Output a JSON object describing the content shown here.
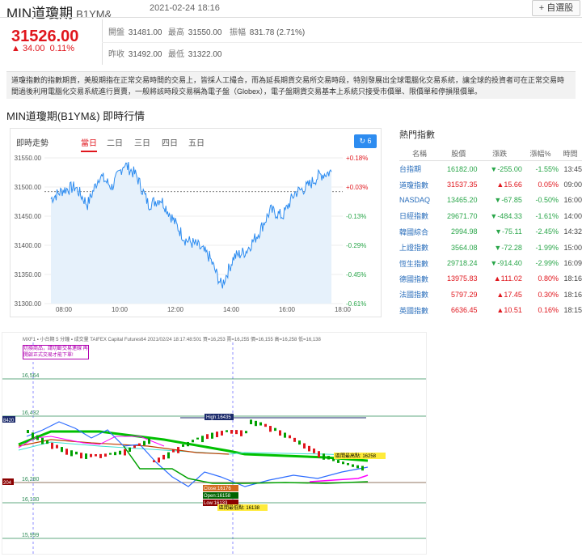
{
  "header": {
    "title": "MIN道瓊期",
    "code": "B1YM&",
    "datetime": "2021-02-24 18:16",
    "watch_button": "+ 自選股"
  },
  "quote": {
    "price": "31526.00",
    "change": "▲ 34.00",
    "change_pct": "0.11%",
    "open_label": "開盤",
    "open": "31481.00",
    "high_label": "最高",
    "high": "31550.00",
    "amp_label": "振幅",
    "amp": "831.78 (2.71%)",
    "prev_label": "昨收",
    "prev": "31492.00",
    "low_label": "最低",
    "low": "31322.00"
  },
  "description": "道瓊指數的指數期貨，美股期指在正常交易時間的交易上，皆採人工撮合，而為延長期貨交易所交易時段，特別發展出全球電腦化交易系統，讓全球的投資者可在正常交易時間過後利用電腦化交易系統進行買賣，一般將該時段交易稱為電子盤（Globex），電子盤期貨交易基本上系統只接受市價單、限價單和停損限價單。",
  "subtitle": "MIN道瓊期(B1YM&) 即時行情",
  "chart_panel": {
    "title": "即時走勢",
    "tabs": [
      "當日",
      "二日",
      "三日",
      "四日",
      "五日"
    ],
    "active_tab": "當日",
    "refresh_label": "↻ 6",
    "y_ticks": [
      "31550.00",
      "31500.00",
      "31450.00",
      "31400.00",
      "31350.00",
      "31300.00"
    ],
    "pct_ticks": [
      "+0.18%",
      "+0.03%",
      "-0.13%",
      "-0.29%",
      "-0.45%",
      "-0.61%"
    ],
    "x_ticks": [
      "08:00",
      "10:00",
      "12:00",
      "14:00",
      "16:00",
      "18:00"
    ]
  },
  "chart_data": {
    "type": "line",
    "title": "即時走勢",
    "x": [
      "07:00",
      "07:30",
      "08:00",
      "08:30",
      "09:00",
      "09:30",
      "10:00",
      "10:30",
      "11:00",
      "11:30",
      "12:00",
      "12:30",
      "13:00",
      "13:30",
      "14:00",
      "14:30",
      "15:00",
      "15:30",
      "16:00",
      "16:30",
      "17:00",
      "17:30",
      "18:00",
      "18:16"
    ],
    "values": [
      31480,
      31495,
      31500,
      31470,
      31520,
      31500,
      31540,
      31520,
      31470,
      31480,
      31445,
      31410,
      31400,
      31380,
      31330,
      31380,
      31390,
      31420,
      31460,
      31450,
      31490,
      31500,
      31520,
      31526
    ],
    "reference": 31492,
    "ylim": [
      31300,
      31550
    ],
    "grid": true
  },
  "hot": {
    "title": "熱門指數",
    "headers": [
      "名稱",
      "股價",
      "漲跌",
      "漲幅%",
      "時間"
    ],
    "rows": [
      {
        "name": "台指期",
        "price": "16182.00",
        "change": "▼-255.00",
        "pct": "-1.55%",
        "time": "13:45",
        "dir": "dn"
      },
      {
        "name": "道瓊指數",
        "price": "31537.35",
        "change": "▲15.66",
        "pct": "0.05%",
        "time": "09:00",
        "dir": "up"
      },
      {
        "name": "NASDAQ",
        "price": "13465.20",
        "change": "▼-67.85",
        "pct": "-0.50%",
        "time": "16:00",
        "dir": "dn"
      },
      {
        "name": "日經指數",
        "price": "29671.70",
        "change": "▼-484.33",
        "pct": "-1.61%",
        "time": "14:00",
        "dir": "dn"
      },
      {
        "name": "韓國綜合",
        "price": "2994.98",
        "change": "▼-75.11",
        "pct": "-2.45%",
        "time": "14:32",
        "dir": "dn"
      },
      {
        "name": "上證指數",
        "price": "3564.08",
        "change": "▼-72.28",
        "pct": "-1.99%",
        "time": "15:00",
        "dir": "dn"
      },
      {
        "name": "恆生指數",
        "price": "29718.24",
        "change": "▼-914.40",
        "pct": "-2.99%",
        "time": "16:09",
        "dir": "dn"
      },
      {
        "name": "德國指數",
        "price": "13975.83",
        "change": "▲111.02",
        "pct": "0.80%",
        "time": "18:16",
        "dir": "up"
      },
      {
        "name": "法國指數",
        "price": "5797.29",
        "change": "▲17.45",
        "pct": "0.30%",
        "time": "18:16",
        "dir": "up"
      },
      {
        "name": "英國指數",
        "price": "6636.45",
        "change": "▲10.51",
        "pct": "0.16%",
        "time": "18:15",
        "dir": "up"
      }
    ]
  },
  "tv": {
    "toolbar": "MXF1 ▪ 小台期 5 分鐘 ▪ 成交量 TAIFEX Capital Futures64 2021/02/24 18:17:48:501 買=16,253 賣=16,255 價=16,155 高=16,258 低=16,138",
    "notice": "切換商品，請切斷交易連線 再開啟正式交易才能下單!",
    "y_labels": [
      "16,564",
      "16,432",
      "16,280",
      "16,130",
      "15,999"
    ],
    "left_tags": [
      "8420",
      "204"
    ],
    "high_tag": "High:16435",
    "close_tag": "Close:16176",
    "open_tag": "Open:16158",
    "low_tag": "Low:16133",
    "period_high": "區間最高點: 16258",
    "period_low": "區間最低點: 16138"
  },
  "colors": {
    "up": "#e0161d",
    "down": "#2aa64a",
    "accent": "#2d8cf0"
  }
}
